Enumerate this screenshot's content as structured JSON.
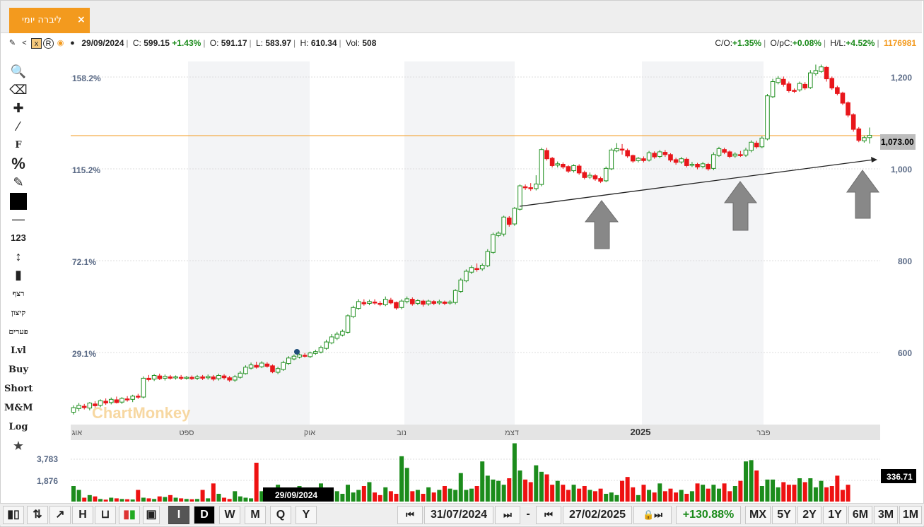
{
  "tab": {
    "title": "ליברה יומי",
    "close": "×"
  },
  "info": {
    "date": "29/09/2024",
    "close_label": "C:",
    "close_val": "599.15",
    "close_chg": "+1.43%",
    "open_label": "O:",
    "open_val": "591.17",
    "low_label": "L:",
    "low_val": "583.97",
    "high_label": "H:",
    "high_val": "610.34",
    "vol_label": "Vol:",
    "vol_val": "508",
    "co_label": "C/O:",
    "co_val": "+1.35%",
    "opc_label": "O/pC:",
    "opc_val": "+0.08%",
    "hl_label": "H/L:",
    "hl_val": "+4.52%",
    "id": "1176981"
  },
  "left_tools": {
    "cycle": "רצף",
    "compress": "קיצון",
    "gaps": "פערים",
    "lvl": "Lvl",
    "buy": "Buy",
    "short": "Short",
    "mm": "M&M",
    "log": "Log",
    "num": "123",
    "fib": "F",
    "pct": "%"
  },
  "axis": {
    "left_pct": [
      "158.2%",
      "115.2%",
      "72.1%",
      "29.1%"
    ],
    "right_price": [
      "1,200",
      "1,000",
      "800",
      "600"
    ],
    "current_price": "1,073.00",
    "vol_ticks": [
      "3,783",
      "1,876"
    ],
    "vol_current": "336.71",
    "months": [
      "אוג",
      "ספט",
      "אוק",
      "נוב",
      "דצמ",
      "2025",
      "פבר"
    ],
    "crosshair_date": "29/09/2024"
  },
  "watermark": "ChartMonkey",
  "bottom": {
    "intervals": [
      "I",
      "D",
      "W",
      "M",
      "Q",
      "Y"
    ],
    "start_date": "31/07/2024",
    "end_date": "27/02/2025",
    "dash": "-",
    "change": "+130.88%",
    "ranges": [
      "MX",
      "5Y",
      "2Y",
      "1Y",
      "6M",
      "3M",
      "1M"
    ]
  },
  "chart_data": {
    "type": "candlestick",
    "price_range": [
      440,
      1240
    ],
    "resistance": 1073,
    "candles": [
      [
        470,
        480,
        465,
        485
      ],
      [
        478,
        485,
        472,
        490
      ],
      [
        483,
        480,
        476,
        488
      ],
      [
        479,
        490,
        474,
        492
      ],
      [
        488,
        484,
        480,
        494
      ],
      [
        485,
        495,
        481,
        498
      ],
      [
        494,
        490,
        486,
        500
      ],
      [
        491,
        498,
        487,
        502
      ],
      [
        497,
        491,
        489,
        504
      ],
      [
        492,
        500,
        488,
        503
      ],
      [
        499,
        497,
        493,
        505
      ],
      [
        498,
        505,
        492,
        508
      ],
      [
        505,
        503,
        499,
        510
      ],
      [
        503,
        544,
        500,
        548
      ],
      [
        544,
        541,
        537,
        551
      ],
      [
        542,
        550,
        538,
        553
      ],
      [
        549,
        543,
        540,
        554
      ],
      [
        544,
        548,
        539,
        552
      ],
      [
        547,
        544,
        541,
        551
      ],
      [
        545,
        547,
        541,
        550
      ],
      [
        546,
        544,
        540,
        551
      ],
      [
        545,
        546,
        541,
        549
      ],
      [
        546,
        543,
        540,
        550
      ],
      [
        544,
        547,
        540,
        551
      ],
      [
        547,
        544,
        540,
        551
      ],
      [
        545,
        548,
        541,
        552
      ],
      [
        547,
        542,
        538,
        551
      ],
      [
        543,
        550,
        539,
        554
      ],
      [
        549,
        545,
        541,
        553
      ],
      [
        545,
        540,
        536,
        549
      ],
      [
        540,
        547,
        536,
        551
      ],
      [
        546,
        555,
        543,
        560
      ],
      [
        554,
        568,
        552,
        572
      ],
      [
        566,
        573,
        563,
        578
      ],
      [
        572,
        568,
        565,
        580
      ],
      [
        569,
        577,
        566,
        581
      ],
      [
        575,
        570,
        567,
        579
      ],
      [
        571,
        558,
        555,
        574
      ],
      [
        557,
        565,
        553,
        569
      ],
      [
        563,
        578,
        560,
        582
      ],
      [
        576,
        588,
        573,
        592
      ],
      [
        586,
        592,
        583,
        596
      ],
      [
        590,
        595,
        587,
        598
      ],
      [
        594,
        592,
        589,
        599
      ],
      [
        591,
        599,
        588,
        602
      ],
      [
        598,
        602,
        595,
        606
      ],
      [
        601,
        611,
        598,
        615
      ],
      [
        609,
        623,
        606,
        628
      ],
      [
        621,
        634,
        618,
        640
      ],
      [
        631,
        640,
        627,
        645
      ],
      [
        638,
        646,
        635,
        650
      ],
      [
        644,
        680,
        641,
        683
      ],
      [
        678,
        698,
        675,
        702
      ],
      [
        696,
        711,
        693,
        716
      ],
      [
        709,
        706,
        702,
        716
      ],
      [
        707,
        711,
        703,
        715
      ],
      [
        710,
        708,
        704,
        716
      ],
      [
        707,
        705,
        701,
        712
      ],
      [
        704,
        716,
        701,
        722
      ],
      [
        714,
        708,
        705,
        719
      ],
      [
        709,
        697,
        693,
        711
      ],
      [
        698,
        712,
        694,
        716
      ],
      [
        711,
        717,
        707,
        722
      ],
      [
        716,
        706,
        702,
        720
      ],
      [
        707,
        713,
        703,
        716
      ],
      [
        712,
        705,
        700,
        715
      ],
      [
        706,
        712,
        702,
        715
      ],
      [
        711,
        707,
        703,
        714
      ],
      [
        708,
        711,
        704,
        715
      ],
      [
        710,
        707,
        703,
        713
      ],
      [
        708,
        710,
        704,
        714
      ],
      [
        709,
        735,
        705,
        738
      ],
      [
        733,
        758,
        730,
        762
      ],
      [
        756,
        777,
        753,
        781
      ],
      [
        775,
        785,
        771,
        790
      ],
      [
        783,
        781,
        776,
        794
      ],
      [
        782,
        790,
        778,
        794
      ],
      [
        789,
        820,
        786,
        825
      ],
      [
        818,
        857,
        815,
        861
      ],
      [
        855,
        860,
        851,
        864
      ],
      [
        858,
        895,
        853,
        898
      ],
      [
        893,
        879,
        874,
        897
      ],
      [
        880,
        914,
        876,
        917
      ],
      [
        912,
        963,
        909,
        966
      ],
      [
        961,
        960,
        954,
        966
      ],
      [
        959,
        957,
        952,
        969
      ],
      [
        957,
        967,
        953,
        986
      ],
      [
        966,
        1042,
        962,
        1046
      ],
      [
        1040,
        1022,
        1018,
        1046
      ],
      [
        1023,
        1007,
        1003,
        1026
      ],
      [
        1008,
        1011,
        1003,
        1016
      ],
      [
        1010,
        1004,
        1000,
        1014
      ],
      [
        1005,
        995,
        991,
        1008
      ],
      [
        996,
        1007,
        992,
        1010
      ],
      [
        1006,
        991,
        987,
        1010
      ],
      [
        992,
        981,
        977,
        996
      ],
      [
        982,
        986,
        978,
        992
      ],
      [
        985,
        978,
        974,
        989
      ],
      [
        979,
        973,
        969,
        983
      ],
      [
        974,
        1001,
        971,
        1005
      ],
      [
        1000,
        1041,
        997,
        1045
      ],
      [
        1039,
        1044,
        1036,
        1056
      ],
      [
        1043,
        1041,
        1031,
        1054
      ],
      [
        1040,
        1028,
        1024,
        1044
      ],
      [
        1029,
        1017,
        1013,
        1031
      ],
      [
        1018,
        1023,
        1014,
        1026
      ],
      [
        1022,
        1018,
        1014,
        1027
      ],
      [
        1019,
        1035,
        1016,
        1039
      ],
      [
        1034,
        1026,
        1022,
        1038
      ],
      [
        1027,
        1037,
        1023,
        1041
      ],
      [
        1036,
        1031,
        1026,
        1041
      ],
      [
        1031,
        1019,
        1015,
        1034
      ],
      [
        1020,
        1014,
        1009,
        1024
      ],
      [
        1015,
        1022,
        1011,
        1026
      ],
      [
        1021,
        1007,
        1003,
        1025
      ],
      [
        1008,
        1010,
        1004,
        1015
      ],
      [
        1010,
        1004,
        999,
        1013
      ],
      [
        1005,
        1011,
        1001,
        1015
      ],
      [
        1010,
        1000,
        996,
        1013
      ],
      [
        1001,
        1031,
        997,
        1036
      ],
      [
        1029,
        1044,
        1026,
        1048
      ],
      [
        1042,
        1036,
        1032,
        1046
      ],
      [
        1037,
        1027,
        1023,
        1040
      ],
      [
        1028,
        1032,
        1024,
        1036
      ],
      [
        1031,
        1030,
        1026,
        1039
      ],
      [
        1030,
        1041,
        1026,
        1046
      ],
      [
        1040,
        1058,
        1036,
        1062
      ],
      [
        1056,
        1048,
        1044,
        1061
      ],
      [
        1048,
        1067,
        1045,
        1071
      ],
      [
        1065,
        1159,
        1062,
        1163
      ],
      [
        1157,
        1190,
        1154,
        1196
      ],
      [
        1188,
        1197,
        1184,
        1202
      ],
      [
        1195,
        1184,
        1179,
        1201
      ],
      [
        1185,
        1170,
        1166,
        1190
      ],
      [
        1171,
        1170,
        1165,
        1175
      ],
      [
        1172,
        1186,
        1168,
        1190
      ],
      [
        1184,
        1176,
        1172,
        1189
      ],
      [
        1177,
        1209,
        1174,
        1215
      ],
      [
        1207,
        1214,
        1203,
        1227
      ],
      [
        1212,
        1222,
        1209,
        1227
      ],
      [
        1221,
        1196,
        1190,
        1224
      ],
      [
        1197,
        1176,
        1172,
        1201
      ],
      [
        1177,
        1164,
        1160,
        1181
      ],
      [
        1165,
        1143,
        1139,
        1168
      ],
      [
        1144,
        1117,
        1112,
        1147
      ],
      [
        1118,
        1086,
        1081,
        1121
      ],
      [
        1087,
        1062,
        1058,
        1091
      ],
      [
        1061,
        1068,
        1057,
        1072
      ],
      [
        1068,
        1073,
        1055,
        1090
      ]
    ],
    "volume": [
      1200,
      900,
      300,
      500,
      400,
      200,
      150,
      300,
      250,
      200,
      180,
      160,
      900,
      300,
      250,
      200,
      400,
      350,
      500,
      300,
      250,
      200,
      180,
      200,
      900,
      250,
      1400,
      600,
      300,
      200,
      800,
      400,
      300,
      250,
      3000,
      800,
      600,
      500,
      1300,
      500,
      900,
      700,
      1200,
      600,
      900,
      700,
      1400,
      1000,
      900,
      800,
      600,
      1300,
      700,
      900,
      1200,
      1500,
      700,
      500,
      1100,
      800,
      600,
      3500,
      2600,
      800,
      900,
      600,
      1100,
      700,
      900,
      1200,
      1000,
      900,
      2200,
      900,
      1000,
      1200,
      3100,
      2000,
      1700,
      1600,
      1300,
      1800,
      4500,
      2400,
      1700,
      1500,
      2800,
      2300,
      2100,
      1300,
      1600,
      1300,
      900,
      1300,
      1000,
      1200,
      900,
      800,
      1000,
      600,
      700,
      500,
      1600,
      1900,
      1100,
      500,
      1300,
      900,
      700,
      1400,
      800,
      1000,
      700,
      900,
      600,
      800,
      1400,
      1300,
      1000,
      1300,
      1000,
      1400,
      800,
      1200,
      1600,
      3100,
      3200,
      2400,
      1200,
      1700,
      1700,
      1100,
      1500,
      1300,
      1300,
      1800,
      1500,
      1800,
      1100,
      1600,
      1100,
      1200,
      2000,
      900,
      1300
    ]
  }
}
